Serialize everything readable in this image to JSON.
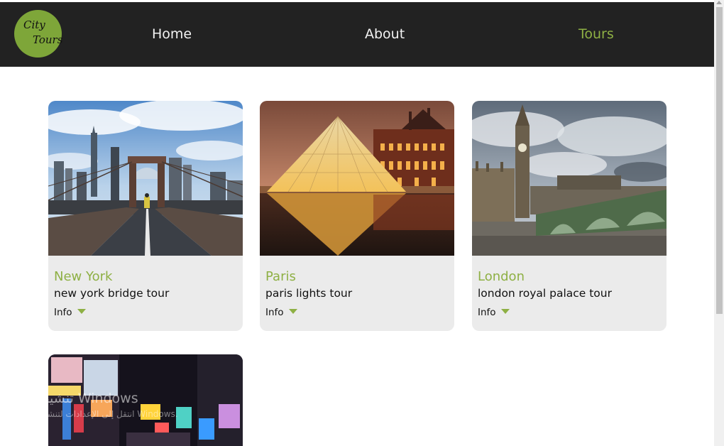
{
  "logo": {
    "line1": "City",
    "line2": "Tours"
  },
  "nav": {
    "home": "Home",
    "about": "About",
    "tours": "Tours"
  },
  "tours": [
    {
      "city": "New York",
      "tour": "new york bridge tour",
      "info": "Info"
    },
    {
      "city": "Paris",
      "tour": "paris lights tour",
      "info": "Info"
    },
    {
      "city": "London",
      "tour": "london royal palace tour",
      "info": "Info"
    }
  ],
  "watermark": {
    "line1": "تنشيط Windows",
    "line2": "انتقل إلى الإعدادات لتنشيط Windows."
  },
  "colors": {
    "accent": "#8eb044",
    "navbar": "#222222",
    "card": "#ebebeb"
  }
}
